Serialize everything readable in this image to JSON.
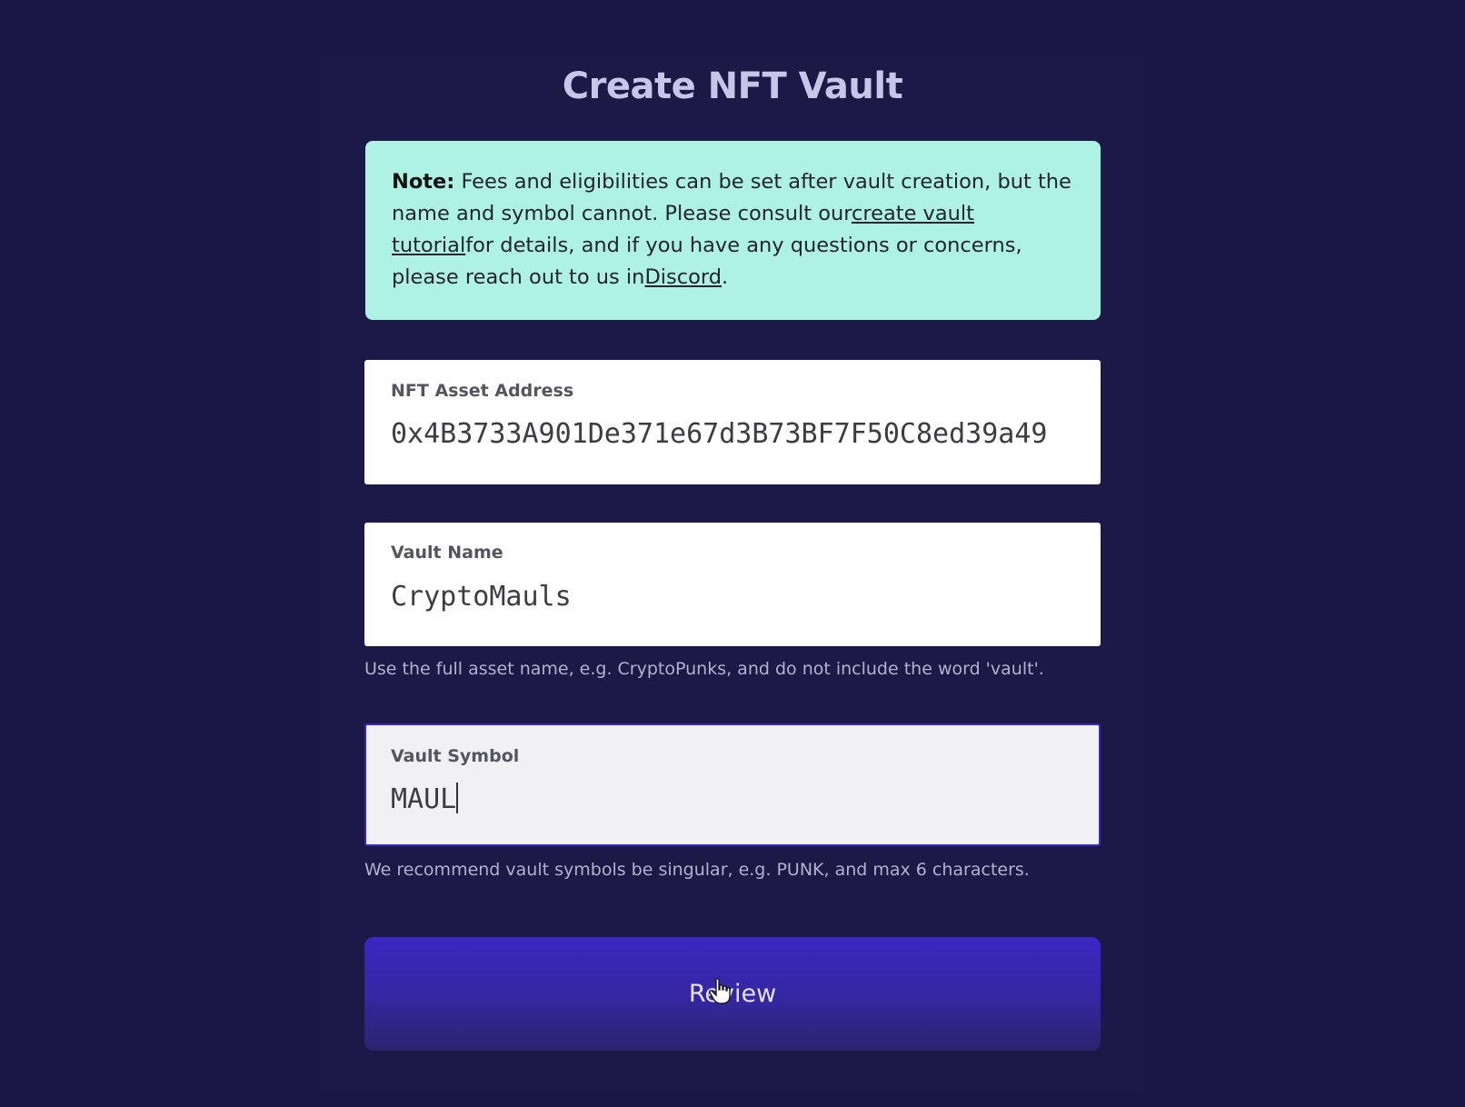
{
  "page": {
    "title": "Create NFT Vault"
  },
  "note": {
    "label": "Note:",
    "text_1": " Fees and eligibilities can be set after vault creation, but the name and symbol cannot. Please consult our",
    "link_tutorial": "create vault tutorial",
    "text_2": "for details, and if you have any questions or concerns, please reach out to us in",
    "link_discord": "Discord",
    "text_3": "."
  },
  "fields": {
    "asset_address": {
      "label": "NFT Asset Address",
      "value": "0x4B3733A901De371e67d3B73BF7F50C8ed39a49"
    },
    "vault_name": {
      "label": "Vault Name",
      "value": "CryptoMauls",
      "hint": "Use the full asset name, e.g. CryptoPunks, and do not include the word 'vault'."
    },
    "vault_symbol": {
      "label": "Vault Symbol",
      "value": "MAUL",
      "hint": "We recommend vault symbols be singular, e.g. PUNK, and max 6 characters."
    }
  },
  "review_button": {
    "label": "Review"
  },
  "colors": {
    "background": "#1b1744",
    "note_bg": "#aef2e3",
    "button_bg": "#3b27c3",
    "focus_border": "#3a25c8"
  }
}
